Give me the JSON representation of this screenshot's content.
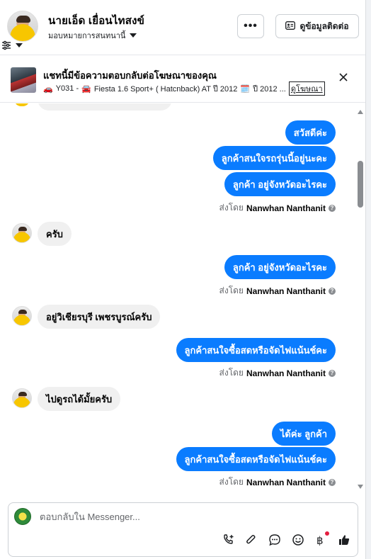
{
  "header": {
    "contact_name": "นายเอ็ด เยื่อนไทสงข์",
    "assign_label": "มอบหมายการสนทนานี้",
    "more_label": "•••",
    "view_contact_label": "ดูข้อมูลติดต่อ"
  },
  "ad_banner": {
    "title": "แชทนี้มีข้อความตอบกลับต่อโฆษณาของคุณ",
    "code": "Y031 -",
    "model": "Fiesta 1.6 Sport+ ( Hatcnback) AT ปี 2012",
    "year": "ปี 2012 ...",
    "view_ad_label": "ดูโฆษณา"
  },
  "messages": {
    "m1": "สวัสดีค่ะ",
    "m2": "ลูกค้าสนใจรถรุ่นนี้อยู่นะคะ",
    "m3": "ลูกค้า อยู่จังหวัดอะไรคะ",
    "m4": "ครับ",
    "m5": "ลูกค้า อยู่จังหวัดอะไรคะ",
    "m6": "อยู่วิเชียรบุรี เพชรบูรณ์ครับ",
    "m7": "ลูกค้าสนใจซื้อสดหรือจัดไฟแน้นช์คะ",
    "m8": "ไปดูรถได้มั้ยครับ",
    "m9": "ได้ค่ะ  ลูกค้า",
    "m10": "ลูกค้าสนใจซื้อสดหรือจัดไฟแน้นช์คะ"
  },
  "sent_by": {
    "prefix": "ส่งโดย",
    "agent_name": "Nanwhan Nanthanit"
  },
  "composer": {
    "placeholder": "ตอบกลับใน Messenger..."
  },
  "icons": [
    "filter-icon",
    "chevron-down-icon",
    "more-icon",
    "contact-card-icon",
    "close-icon",
    "info-icon",
    "add-contact-icon",
    "attachment-icon",
    "saved-reply-icon",
    "emoji-icon",
    "payment-icon",
    "like-icon"
  ],
  "colors": {
    "outgoing_bubble": "#0a7cff",
    "incoming_bubble": "#f0f0f0",
    "notification_dot": "#e41e3f"
  }
}
